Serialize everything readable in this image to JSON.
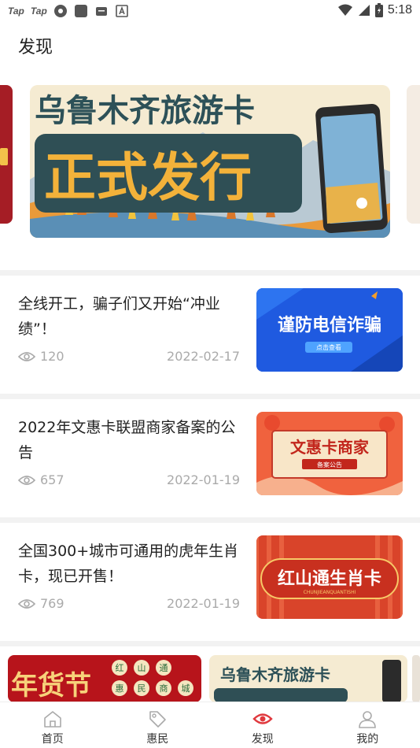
{
  "status_bar": {
    "app1": "Tap",
    "app2": "Tap",
    "time": "5:18"
  },
  "header": {
    "title": "发现"
  },
  "banner": {
    "main_line1": "乌鲁木齐旅游卡",
    "main_line2": "正式发行"
  },
  "news": [
    {
      "title": "全线开工，骗子们又开始“冲业绩”！",
      "views": "120",
      "date": "2022-02-17",
      "thumb_text": "谨防电信诈骗",
      "thumb_sub": "点击查看"
    },
    {
      "title": "2022年文惠卡联盟商家备案的公告",
      "views": "657",
      "date": "2022-01-19",
      "thumb_text": "文惠卡商家",
      "thumb_sub": "备案公告"
    },
    {
      "title": "全国300+城市可通用的虎年生肖卡，现已开售！",
      "views": "769",
      "date": "2022-01-19",
      "thumb_text": "红山通生肖卡",
      "thumb_sub": "CHUNJIEANQUANTISHI"
    }
  ],
  "promo": {
    "left_big": "年货节",
    "left_tags": [
      "红",
      "山",
      "通",
      "惠",
      "民",
      "商",
      "城"
    ],
    "right_text": "乌鲁木齐旅游卡"
  },
  "bottom_nav": [
    {
      "label": "首页",
      "icon": "home-icon"
    },
    {
      "label": "惠民",
      "icon": "tag-icon"
    },
    {
      "label": "发现",
      "icon": "eye-icon"
    },
    {
      "label": "我的",
      "icon": "user-icon"
    }
  ],
  "colors": {
    "accent": "#e0393e",
    "meta_gray": "#aaaaaa",
    "divider": "#f2f2f2"
  }
}
